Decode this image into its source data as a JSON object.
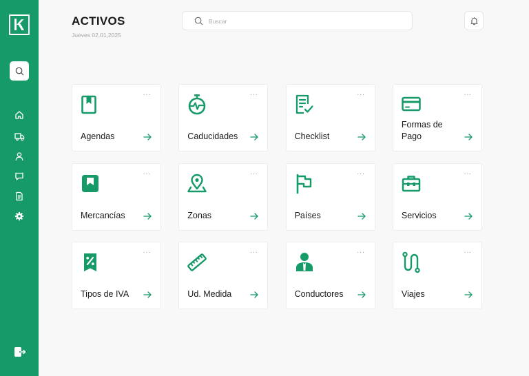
{
  "header": {
    "title": "ACTIVOS",
    "date": "Jueves 02,01,2025"
  },
  "search": {
    "placeholder": "Buscar"
  },
  "colors": {
    "brand": "#169b68",
    "background": "#f8f8f8",
    "card": "#ffffff"
  },
  "sidebar": {
    "logo_icon": "k-logo-icon",
    "search_icon": "search-icon",
    "items": [
      {
        "icon": "home-icon"
      },
      {
        "icon": "truck-icon"
      },
      {
        "icon": "user-icon"
      },
      {
        "icon": "chat-icon"
      },
      {
        "icon": "document-icon"
      },
      {
        "icon": "gear-icon"
      }
    ],
    "logout_icon": "logout-icon"
  },
  "cards": [
    {
      "label": "Agendas",
      "icon": "bookmark-book-icon",
      "more": "···"
    },
    {
      "label": "Caducidades",
      "icon": "stopwatch-icon",
      "more": "···"
    },
    {
      "label": "Checklist",
      "icon": "checklist-icon",
      "more": "···"
    },
    {
      "label": "Formas de Pago",
      "icon": "credit-card-icon",
      "more": "···"
    },
    {
      "label": "Mercancías",
      "icon": "box-icon",
      "more": "···"
    },
    {
      "label": "Zonas",
      "icon": "map-pin-icon",
      "more": "···"
    },
    {
      "label": "Países",
      "icon": "flag-icon",
      "more": "···"
    },
    {
      "label": "Servicios",
      "icon": "toolbox-icon",
      "more": "···"
    },
    {
      "label": "Tipos de IVA",
      "icon": "percent-tag-icon",
      "more": "···"
    },
    {
      "label": "Ud. Medida",
      "icon": "ruler-icon",
      "more": "···"
    },
    {
      "label": "Conductores",
      "icon": "driver-icon",
      "more": "···"
    },
    {
      "label": "Viajes",
      "icon": "route-icon",
      "more": "···"
    }
  ]
}
